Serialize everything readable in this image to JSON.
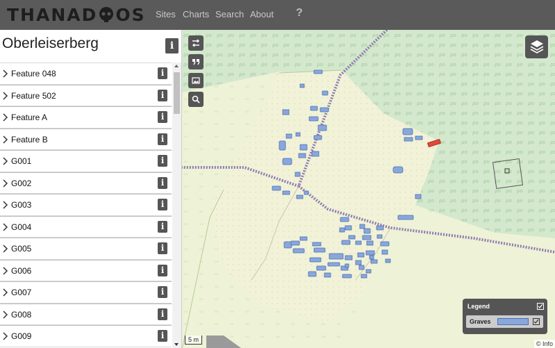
{
  "header": {
    "logo_text_left": "THANA",
    "logo_text_right": "OS",
    "logo_text_mid": "D",
    "nav": [
      "Sites",
      "Charts",
      "Search",
      "About"
    ],
    "help": "?"
  },
  "sidebar": {
    "site_title": "Oberleiserberg",
    "info_glyph": "i",
    "items": [
      {
        "label": "Feature 048"
      },
      {
        "label": "Feature 502"
      },
      {
        "label": "Feature A"
      },
      {
        "label": "Feature B"
      },
      {
        "label": "G001"
      },
      {
        "label": "G002"
      },
      {
        "label": "G003"
      },
      {
        "label": "G004"
      },
      {
        "label": "G005"
      },
      {
        "label": "G006"
      },
      {
        "label": "G007"
      },
      {
        "label": "G008"
      },
      {
        "label": "G009"
      }
    ]
  },
  "map": {
    "legend": {
      "title": "Legend",
      "layer": "Graves",
      "checked": true,
      "layer_checked": true
    },
    "scale_label": "5 m",
    "attribution": "© Info",
    "colors": {
      "forest": "#d4e8cd",
      "meadow": "#eef2d8",
      "grave_fill": "#8aa7dc",
      "grave_stroke": "#4a6fb0",
      "selected": "#e04a3a"
    },
    "controls": [
      "swap-icon",
      "quote-icon",
      "image-icon",
      "search-icon"
    ]
  }
}
